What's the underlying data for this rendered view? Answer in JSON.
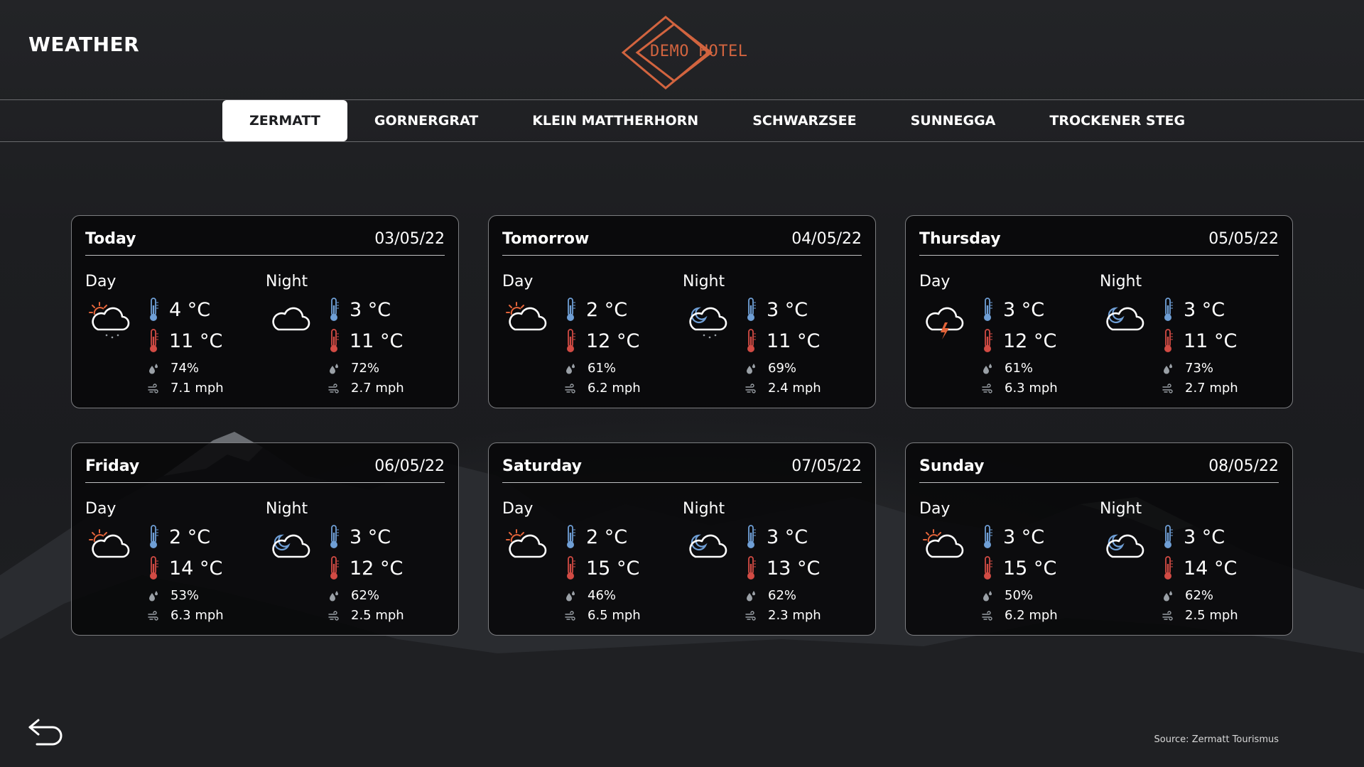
{
  "header": {
    "title": "WEATHER",
    "logo_text": "DEMO HOTEL",
    "logo_color": "#d2643f"
  },
  "tabs": [
    {
      "label": "ZERMATT",
      "active": true
    },
    {
      "label": "GORNERGRAT",
      "active": false
    },
    {
      "label": "KLEIN MATTHERHORN",
      "active": false
    },
    {
      "label": "SCHWARZSEE",
      "active": false
    },
    {
      "label": "SUNNEGGA",
      "active": false
    },
    {
      "label": "TROCKENER STEG",
      "active": false
    }
  ],
  "labels": {
    "day": "Day",
    "night": "Night"
  },
  "forecast": [
    {
      "name": "Today",
      "date": "03/05/22",
      "day": {
        "icon": "sun-cloud-rain-icon",
        "low": "4 °C",
        "high": "11 °C",
        "humidity": "74%",
        "wind": "7.1 mph"
      },
      "night": {
        "icon": "cloud-icon",
        "low": "3 °C",
        "high": "11 °C",
        "humidity": "72%",
        "wind": "2.7 mph"
      }
    },
    {
      "name": "Tomorrow",
      "date": "04/05/22",
      "day": {
        "icon": "sun-cloud-icon",
        "low": "2 °C",
        "high": "12 °C",
        "humidity": "61%",
        "wind": "6.2 mph"
      },
      "night": {
        "icon": "moon-cloud-rain-icon",
        "low": "3 °C",
        "high": "11 °C",
        "humidity": "69%",
        "wind": "2.4 mph"
      }
    },
    {
      "name": "Thursday",
      "date": "05/05/22",
      "day": {
        "icon": "thunderstorm-icon",
        "low": "3 °C",
        "high": "12 °C",
        "humidity": "61%",
        "wind": "6.3 mph"
      },
      "night": {
        "icon": "moon-cloud-icon",
        "low": "3 °C",
        "high": "11 °C",
        "humidity": "73%",
        "wind": "2.7 mph"
      }
    },
    {
      "name": "Friday",
      "date": "06/05/22",
      "day": {
        "icon": "sun-cloud-icon",
        "low": "2 °C",
        "high": "14 °C",
        "humidity": "53%",
        "wind": "6.3 mph"
      },
      "night": {
        "icon": "moon-cloud-icon",
        "low": "3 °C",
        "high": "12 °C",
        "humidity": "62%",
        "wind": "2.5 mph"
      }
    },
    {
      "name": "Saturday",
      "date": "07/05/22",
      "day": {
        "icon": "sun-cloud-icon",
        "low": "2 °C",
        "high": "15 °C",
        "humidity": "46%",
        "wind": "6.5 mph"
      },
      "night": {
        "icon": "moon-cloud-icon",
        "low": "3 °C",
        "high": "13 °C",
        "humidity": "62%",
        "wind": "2.3 mph"
      }
    },
    {
      "name": "Sunday",
      "date": "08/05/22",
      "day": {
        "icon": "sun-cloud-icon",
        "low": "3 °C",
        "high": "15 °C",
        "humidity": "50%",
        "wind": "6.2 mph"
      },
      "night": {
        "icon": "moon-cloud-icon",
        "low": "3 °C",
        "high": "14 °C",
        "humidity": "62%",
        "wind": "2.5 mph"
      }
    }
  ],
  "colors": {
    "cold": "#6f9fd6",
    "warm": "#d24b44",
    "sun": "#e3643a",
    "bolt": "#e3643a"
  },
  "footer": {
    "source": "Source: Zermatt Tourismus",
    "back_icon": "back-arrow-icon"
  }
}
